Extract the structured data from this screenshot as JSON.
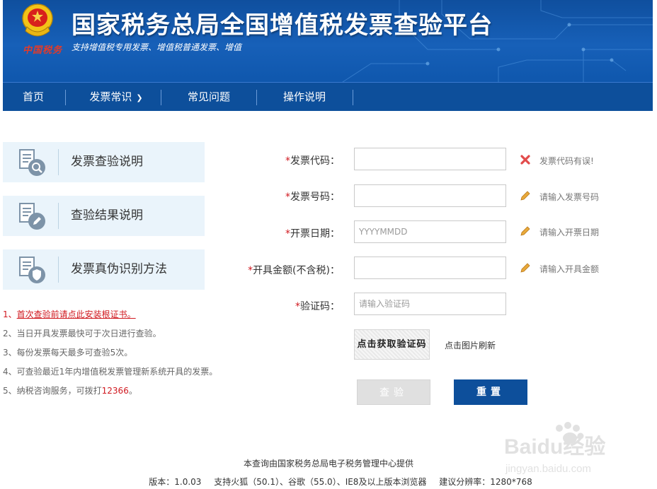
{
  "header": {
    "title": "国家税务总局全国增值税发票查验平台",
    "subtitle": "支持增值税专用发票、增值税普通发票、增值",
    "seal_text": "中国税务"
  },
  "nav": {
    "items": [
      {
        "label": "首页"
      },
      {
        "label": "发票常识"
      },
      {
        "label": "常见问题"
      },
      {
        "label": "操作说明"
      }
    ]
  },
  "sidebar": {
    "cards": [
      {
        "label": "发票查验说明",
        "icon": "doc-search-icon"
      },
      {
        "label": "查验结果说明",
        "icon": "doc-edit-icon"
      },
      {
        "label": "发票真伪识别方法",
        "icon": "doc-shield-icon"
      }
    ]
  },
  "notes": [
    {
      "prefix": "1、",
      "text": "首次查验前请点此安装根证书。"
    },
    {
      "prefix": "2、",
      "text": "当日开具发票最快可于次日进行查验。"
    },
    {
      "prefix": "3、",
      "text": "每份发票每天最多可查验5次。"
    },
    {
      "prefix": "4、",
      "text": "可查验最近1年内增值税发票管理新系统开具的发票。"
    },
    {
      "prefix": "5、",
      "text": "纳税咨询服务，可拨打",
      "hotline": "12366",
      "suffix": "。"
    }
  ],
  "form": {
    "invoice_code": {
      "star": "*",
      "label": "发票代码：",
      "value": "",
      "placeholder": "",
      "hint": "发票代码有误!",
      "hint_icon": "error-x-icon"
    },
    "invoice_number": {
      "star": "*",
      "label": "发票号码：",
      "value": "",
      "placeholder": "",
      "hint": "请输入发票号码",
      "hint_icon": "pencil-icon"
    },
    "issue_date": {
      "star": "*",
      "label": "开票日期：",
      "value": "",
      "placeholder": "YYYYMMDD",
      "hint": "请输入开票日期",
      "hint_icon": "pencil-icon"
    },
    "amount": {
      "star": "*",
      "label": "开具金额(不含税)：",
      "value": "",
      "placeholder": "",
      "hint": "请输入开具金额",
      "hint_icon": "pencil-icon"
    },
    "captcha": {
      "star": "*",
      "label": "验证码：",
      "value": "",
      "placeholder": "请输入验证码"
    },
    "captcha_image_text": "点击获取验证码",
    "refresh_tip": "点击图片刷新",
    "check_label": "查验",
    "reset_label": "重置"
  },
  "footer": {
    "provider": "本查询由国家税务总局电子税务管理中心提供",
    "version": "版本：1.0.03",
    "browsers": "支持火狐（50.1）、谷歌（55.0）、IE8及以上版本浏览器",
    "resolution": "建议分辨率：1280*768"
  },
  "watermark": {
    "line1": "Baidu经验",
    "line2": "jingyan.baidu.com"
  },
  "colors": {
    "brand_blue": "#0d4f9b",
    "header_blue": "#1760b8",
    "required_red": "#d0181f",
    "card_bg": "#eaf4fb"
  }
}
